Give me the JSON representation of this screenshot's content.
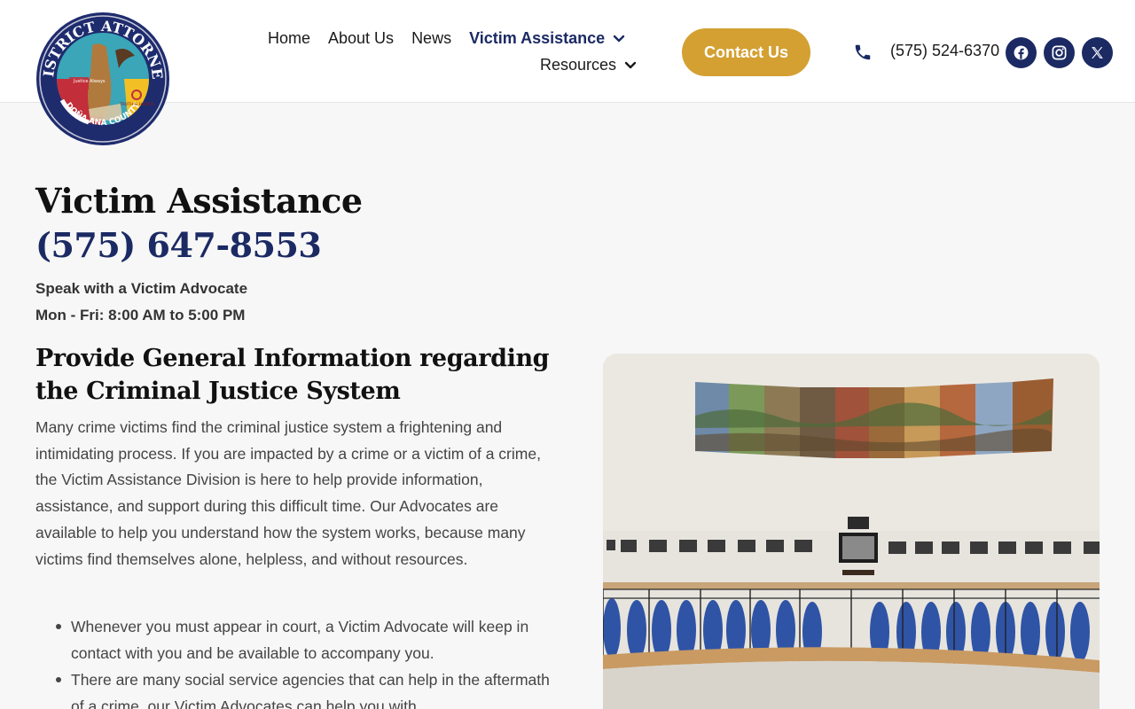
{
  "header": {
    "logo": {
      "top_text": "DISTRICT ATTORNEY",
      "bottom_text": "DOÑA ANA COUNTY",
      "ribbon_left": "Justice Always",
      "ribbon_right": "TRUTH & HONOR"
    },
    "nav": {
      "home": "Home",
      "about": "About Us",
      "news": "News",
      "victim": "Victim Assistance",
      "resources": "Resources"
    },
    "contact_label": "Contact Us",
    "phone": "(575) 524-6370",
    "socials": [
      "facebook",
      "instagram",
      "x"
    ]
  },
  "main": {
    "title": "Victim Assistance",
    "phone": "(575) 647-8553",
    "subtitle": "Speak with a Victim Advocate",
    "hours": "Mon - Fri: 8:00 AM to 5:00 PM",
    "section_title": "Provide General Information regarding the Criminal Justice System",
    "paragraph": "Many crime victims find the criminal justice system a frightening and intimidating process. If you are impacted by a crime or a victim of a crime, the Victim Assistance Division is here to help provide information, assistance, and support during this difficult time. Our Advocates are available to help you understand how the system works, because many victims find themselves alone, helpless, and without resources.",
    "bullets": [
      "Whenever you must appear in court, a Victim Advocate will keep in contact with you and be available to accompany you.",
      "There are many social service agencies that can help in the aftermath of a crime, our Victim Advocates can help you with"
    ]
  },
  "colors": {
    "navy": "#1b2a63",
    "gold": "#d4a032",
    "background": "#f7f7f7"
  },
  "icons": [
    "chevron-down-icon",
    "phone-icon",
    "facebook-icon",
    "instagram-icon",
    "x-icon"
  ]
}
